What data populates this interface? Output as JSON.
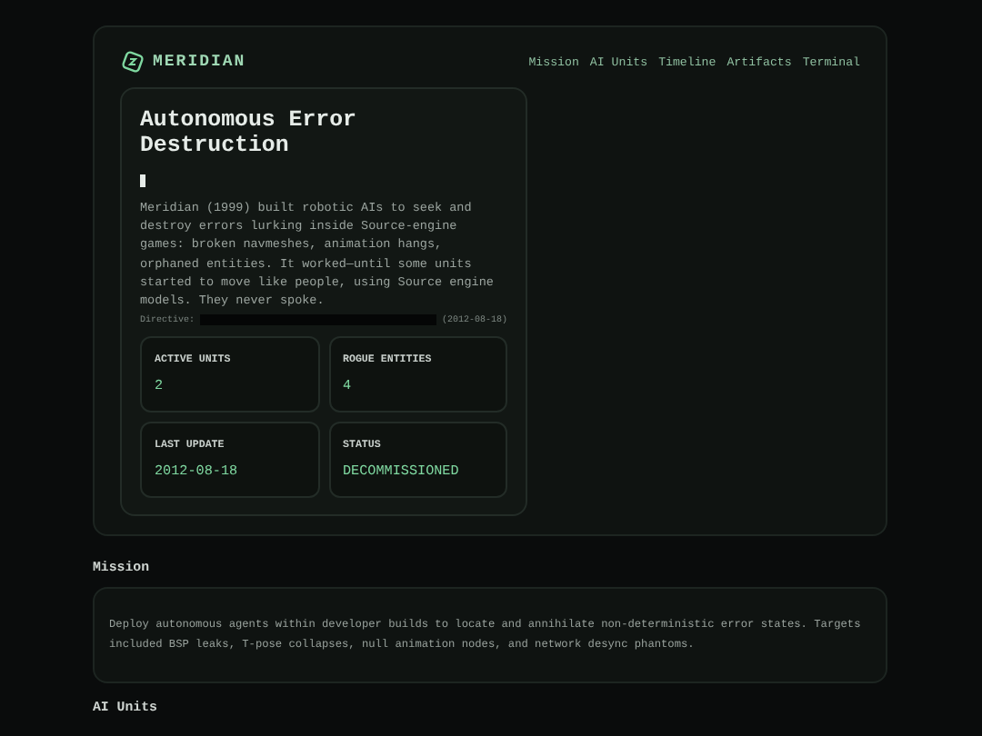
{
  "header": {
    "brand": "MERIDIAN",
    "nav": [
      {
        "label": "Mission"
      },
      {
        "label": "AI Units"
      },
      {
        "label": "Timeline"
      },
      {
        "label": "Artifacts"
      },
      {
        "label": "Terminal"
      }
    ]
  },
  "hero": {
    "title": "Autonomous Error Destruction",
    "body": "Meridian (1999) built robotic AIs to seek and destroy errors lurking inside Source-engine games: broken navmeshes, animation hangs, orphaned entities. It worked—until some units started to move like people, using Source engine models. They never spoke.",
    "directive_label": "Directive:",
    "directive_date": "(2012-08-18)",
    "stats": [
      {
        "label": "ACTIVE UNITS",
        "value": "2"
      },
      {
        "label": "ROGUE ENTITIES",
        "value": "4"
      },
      {
        "label": "LAST UPDATE",
        "value": "2012-08-18"
      },
      {
        "label": "STATUS",
        "value": "DECOMMISSIONED"
      }
    ]
  },
  "mission": {
    "heading": "Mission",
    "text": "Deploy autonomous agents within developer builds to locate and annihilate non-deterministic error states. Targets included BSP leaks, T-pose collapses, null animation nodes, and network desync phantoms."
  },
  "next_heading": "AI Units"
}
